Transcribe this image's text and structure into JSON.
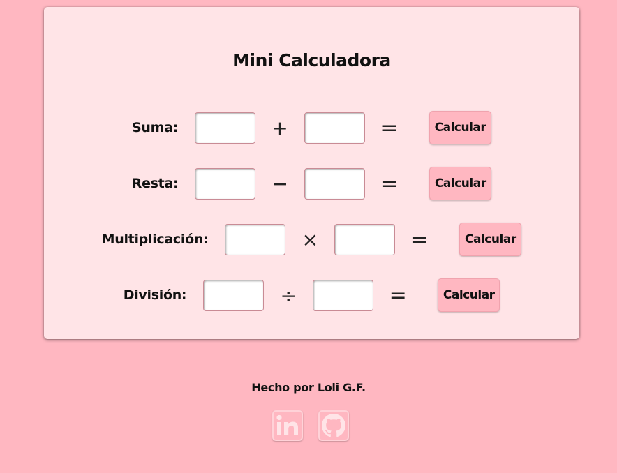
{
  "title": "Mini Calculadora",
  "operations": [
    {
      "label": "Suma:",
      "symbol": "+",
      "equals": "=",
      "button": "Calcular",
      "value_a": "",
      "value_b": ""
    },
    {
      "label": "Resta:",
      "symbol": "−",
      "equals": "=",
      "button": "Calcular",
      "value_a": "",
      "value_b": ""
    },
    {
      "label": "Multiplicación:",
      "symbol": "×",
      "equals": "=",
      "button": "Calcular",
      "value_a": "",
      "value_b": ""
    },
    {
      "label": "División:",
      "symbol": "÷",
      "equals": "=",
      "button": "Calcular",
      "value_a": "",
      "value_b": ""
    }
  ],
  "footer": {
    "credit": "Hecho por Loli G.F."
  },
  "social": [
    {
      "icon": "linkedin-icon"
    },
    {
      "icon": "github-icon"
    }
  ],
  "colors": {
    "background": "#ffb7c1",
    "card": "#ffe4e7",
    "button": "#ffb7c1",
    "icon_light": "#ffe4e7"
  }
}
